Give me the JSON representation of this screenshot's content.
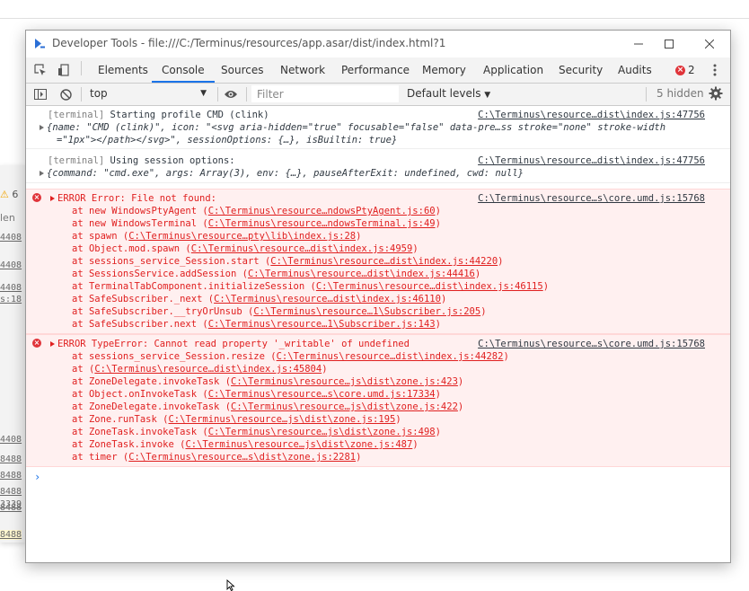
{
  "window": {
    "title": "Developer Tools - file:///C:/Terminus/resources/app.asar/dist/index.html?1"
  },
  "tabs": [
    {
      "label": "Elements"
    },
    {
      "label": "Console"
    },
    {
      "label": "Sources"
    },
    {
      "label": "Network"
    },
    {
      "label": "Performance"
    },
    {
      "label": "Memory"
    },
    {
      "label": "Application"
    },
    {
      "label": "Security"
    },
    {
      "label": "Audits"
    }
  ],
  "active_tab": "Console",
  "error_count": "2",
  "toolbar": {
    "context": "top",
    "filter_placeholder": "Filter",
    "levels": "Default levels",
    "hidden": "5 hidden"
  },
  "messages": [
    {
      "type": "log",
      "prefix": "[terminal]",
      "text": "Starting profile CMD (clink)",
      "source": "C:\\Terminus\\resource…dist\\index.js:47756",
      "object_line1": "{name: \"CMD (clink)\", icon: \"<svg aria-hidden=\"true\" focusable=\"false\" data-pre…ss stroke=\"none\" stroke-width",
      "object_line2": "=\"1px\"></path></svg>\", sessionOptions: {…}, isBuiltin: true}"
    },
    {
      "type": "log",
      "prefix": "[terminal]",
      "text": "Using session options:",
      "source": "C:\\Terminus\\resource…dist\\index.js:47756",
      "object_line1": "{command: \"cmd.exe\", args: Array(3), env: {…}, pauseAfterExit: undefined, cwd: null}"
    },
    {
      "type": "error",
      "text": "ERROR Error: File not found:",
      "source": "C:\\Terminus\\resource…s\\core.umd.js:15768",
      "stack": [
        {
          "fn": "at new WindowsPtyAgent",
          "loc": "C:\\Terminus\\resource…ndowsPtyAgent.js:60"
        },
        {
          "fn": "at new WindowsTerminal",
          "loc": "C:\\Terminus\\resource…ndowsTerminal.js:49"
        },
        {
          "fn": "at spawn",
          "loc": "C:\\Terminus\\resource…pty\\lib\\index.js:28"
        },
        {
          "fn": "at Object.mod.spawn",
          "loc": "C:\\Terminus\\resource…dist\\index.js:4959"
        },
        {
          "fn": "at sessions_service_Session.start",
          "loc": "C:\\Terminus\\resource…dist\\index.js:44220"
        },
        {
          "fn": "at SessionsService.addSession",
          "loc": "C:\\Terminus\\resource…dist\\index.js:44416"
        },
        {
          "fn": "at TerminalTabComponent.initializeSession",
          "loc": "C:\\Terminus\\resource…dist\\index.js:46115"
        },
        {
          "fn": "at SafeSubscriber._next",
          "loc": "C:\\Terminus\\resource…dist\\index.js:46110"
        },
        {
          "fn": "at SafeSubscriber.__tryOrUnsub",
          "loc": "C:\\Terminus\\resource…1\\Subscriber.js:205"
        },
        {
          "fn": "at SafeSubscriber.next",
          "loc": "C:\\Terminus\\resource…1\\Subscriber.js:143"
        }
      ]
    },
    {
      "type": "error",
      "text": "ERROR TypeError: Cannot read property '_writable' of undefined",
      "source": "C:\\Terminus\\resource…s\\core.umd.js:15768",
      "stack": [
        {
          "fn": "at sessions_service_Session.resize",
          "loc": "C:\\Terminus\\resource…dist\\index.js:44282"
        },
        {
          "fn": "at",
          "loc": "C:\\Terminus\\resource…dist\\index.js:45804"
        },
        {
          "fn": "at ZoneDelegate.invokeTask",
          "loc": "C:\\Terminus\\resource…js\\dist\\zone.js:423"
        },
        {
          "fn": "at Object.onInvokeTask",
          "loc": "C:\\Terminus\\resource…s\\core.umd.js:17334"
        },
        {
          "fn": "at ZoneDelegate.invokeTask",
          "loc": "C:\\Terminus\\resource…js\\dist\\zone.js:422"
        },
        {
          "fn": "at Zone.runTask",
          "loc": "C:\\Terminus\\resource…js\\dist\\zone.js:195"
        },
        {
          "fn": "at ZoneTask.invokeTask",
          "loc": "C:\\Terminus\\resource…js\\dist\\zone.js:498"
        },
        {
          "fn": "at ZoneTask.invoke",
          "loc": "C:\\Terminus\\resource…js\\dist\\zone.js:487"
        },
        {
          "fn": "at timer",
          "loc": "C:\\Terminus\\resource…s\\dist\\zone.js:2281"
        }
      ]
    }
  ],
  "prompt_symbol": "›",
  "background": {
    "warn_count": "6",
    "tab_fragment": "len",
    "numbers": [
      "4408",
      "4408",
      "4408",
      "s:18",
      "4408",
      "8488",
      "8488",
      "8488",
      "8488",
      "3339",
      "8488"
    ]
  },
  "icons": {
    "title": "devtools-icon",
    "inspect": "inspect-element-icon",
    "device": "device-toolbar-icon",
    "sidebar": "console-sidebar-icon",
    "clear": "clear-console-icon",
    "eye": "live-expression-icon",
    "gear": "settings-gear-icon",
    "more": "kebab-menu-icon"
  },
  "colors": {
    "accent": "#1a73e8",
    "error_text": "#e02020",
    "error_bg": "#fff0f0",
    "error_badge": "#e0343a"
  }
}
